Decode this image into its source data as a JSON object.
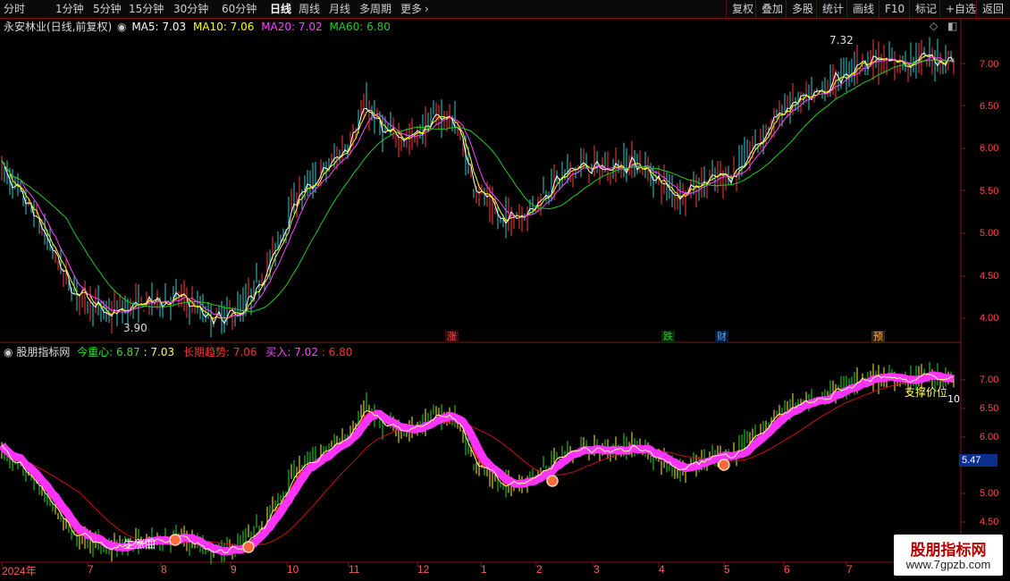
{
  "toolbar": {
    "tabs": [
      "分时",
      "1分钟",
      "5分钟",
      "15分钟",
      "30分钟",
      "60分钟",
      "日线",
      "周线",
      "月线",
      "多周期",
      "更多"
    ],
    "active_tab": "日线",
    "right_buttons": [
      "复权",
      "叠加",
      "多股",
      "统计",
      "画线",
      "F10",
      "标记",
      "+自选",
      "返回"
    ],
    "more_icon": "chevron-right-icon"
  },
  "main_panel": {
    "title": "永安林业(日线,前复权)",
    "ma5_label": "MA5: 7.03",
    "ma10_label": "MA10: 7.06",
    "ma20_label": "MA20: 7.02",
    "ma60_label": "MA60: 6.80",
    "high_annotation": "7.32",
    "low_annotation": "3.90",
    "y_ticks": [
      "7.00",
      "6.50",
      "6.00",
      "5.50",
      "5.00",
      "4.50",
      "4.00"
    ],
    "markers": [
      {
        "text": "涨",
        "color": "#ff4a4a"
      },
      {
        "text": "跌",
        "color": "#22c322"
      },
      {
        "text": "财",
        "color": "#4ab0ff"
      },
      {
        "text": "预",
        "color": "#ffae2e"
      }
    ],
    "colors": {
      "ma5": "#ffffff",
      "ma10": "#ffff00",
      "ma20": "#ff44ff",
      "ma60": "#22cc22",
      "up": "#ff3b3b",
      "down": "#33cccc"
    }
  },
  "indicator_panel": {
    "name": "股朋指标网",
    "line1_label": "今重心: 6.87",
    "line1_extra": ": 7.03",
    "line2_label": "长期趋势: 7.06",
    "line3_label": "买入: 7.02",
    "line3_extra": ": 6.80",
    "y_ticks": [
      "7.00",
      "6.50",
      "6.00",
      "5.00",
      "4.50"
    ],
    "price_tag": "5.47",
    "annotation_support": "支撑价位",
    "annotation_10": "10",
    "annotation_start": "生涨曲",
    "colors": {
      "band": "#ff33ff",
      "red_line": "#ff2020",
      "trend": "#cc1111",
      "up": "#ffee33",
      "down": "#22dd22"
    }
  },
  "dates": [
    "2024年",
    "7",
    "8",
    "9",
    "10",
    "11",
    "12",
    "1",
    "2",
    "3",
    "4",
    "5",
    "6",
    "7"
  ],
  "watermark": {
    "title": "股朋指标网",
    "url": "www.7gpzb.com"
  }
}
